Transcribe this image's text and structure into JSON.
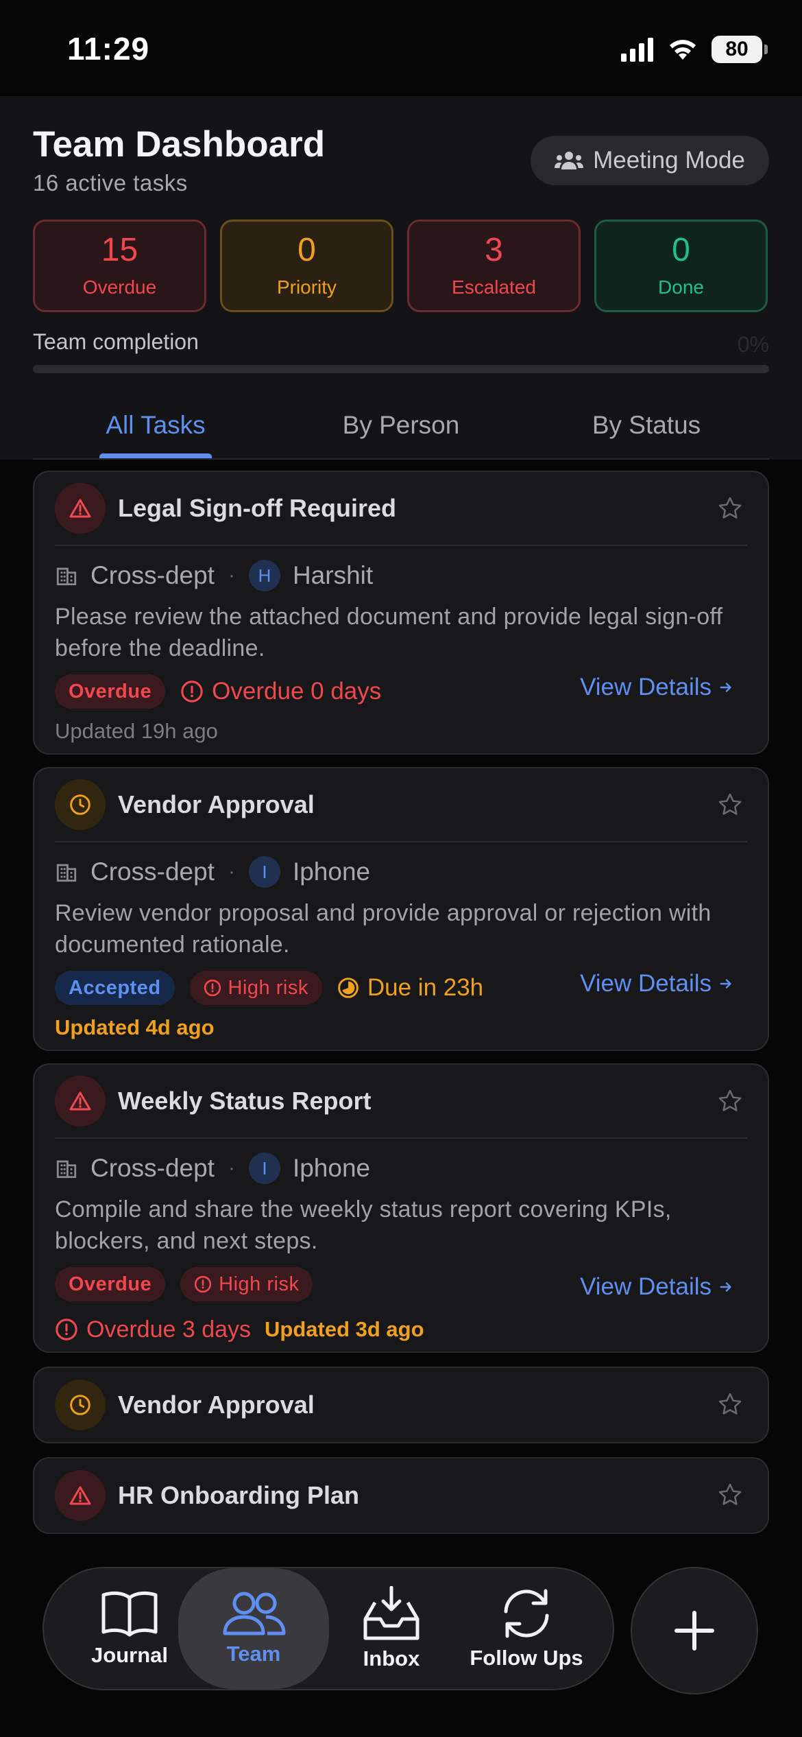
{
  "status_bar": {
    "time": "11:29",
    "battery": "80"
  },
  "header": {
    "title": "Team Dashboard",
    "subtitle": "16 active tasks",
    "meeting_mode_label": "Meeting Mode"
  },
  "stats": [
    {
      "value": "15",
      "label": "Overdue"
    },
    {
      "value": "0",
      "label": "Priority"
    },
    {
      "value": "3",
      "label": "Escalated"
    },
    {
      "value": "0",
      "label": "Done"
    }
  ],
  "completion": {
    "label": "Team completion",
    "percent_text": "0%",
    "fraction": 0
  },
  "tabs": [
    "All Tasks",
    "By Person",
    "By Status"
  ],
  "cards": [
    {
      "title": "Legal Sign-off Required",
      "dept": "Cross-dept",
      "avatar_initial": "H",
      "assignee": "Harshit",
      "description": "Please review the attached document and provide legal sign-off before the deadline.",
      "chip1": "Overdue",
      "inline": "Overdue 0 days",
      "updated": "Updated 19h ago",
      "view": "View Details"
    },
    {
      "title": "Vendor Approval",
      "dept": "Cross-dept",
      "avatar_initial": "I",
      "assignee": "Iphone",
      "description": "Review vendor proposal and provide approval or rejection with documented rationale.",
      "chip1": "Accepted",
      "chip2": "High risk",
      "inline": "Due in 23h",
      "updated": "Updated 4d ago",
      "view": "View Details"
    },
    {
      "title": "Weekly Status Report",
      "dept": "Cross-dept",
      "avatar_initial": "I",
      "assignee": "Iphone",
      "description": "Compile and share the weekly status report covering KPIs, blockers, and next steps.",
      "chip1": "Overdue",
      "chip2": "High risk",
      "inline": "Overdue 3 days",
      "updated": "Updated 3d ago",
      "view": "View Details"
    },
    {
      "title": "Vendor Approval"
    },
    {
      "title": "HR Onboarding Plan"
    }
  ],
  "nav": {
    "journal": "Journal",
    "team": "Team",
    "inbox": "Inbox",
    "follow_ups": "Follow Ups"
  },
  "colors": {
    "accent": "#5f8ff0",
    "red": "#f0484f",
    "amber": "#f0a020",
    "green": "#20c08a"
  }
}
